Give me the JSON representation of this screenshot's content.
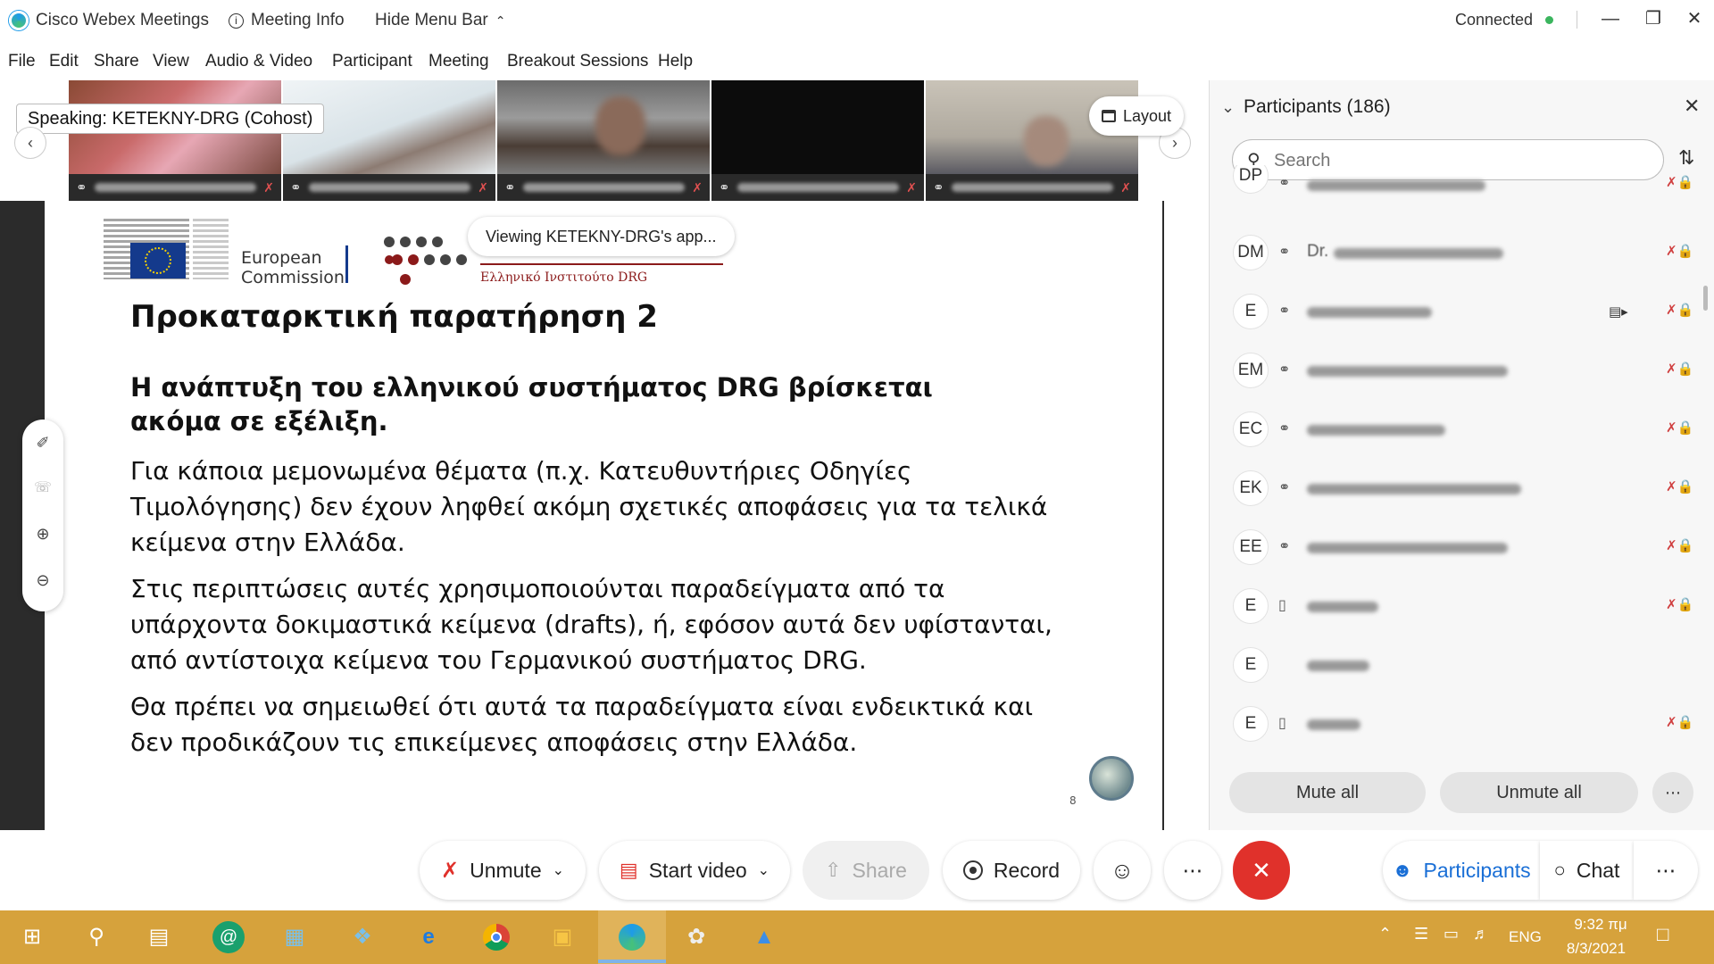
{
  "window": {
    "app_name": "Cisco Webex Meetings",
    "meeting_info": "Meeting Info",
    "hide_menu_bar": "Hide Menu Bar",
    "status": "Connected",
    "status_color": "#3bb55e"
  },
  "menu": [
    "File",
    "Edit",
    "Share",
    "View",
    "Audio & Video",
    "Participant",
    "Meeting",
    "Breakout Sessions",
    "Help"
  ],
  "strip": {
    "speaking": "Speaking: KETEKNY-DRG (Cohost)",
    "layout_label": "Layout"
  },
  "viewing_banner": "Viewing KETEKNY-DRG's app...",
  "slide": {
    "logo_text_line1": "European",
    "logo_text_line2": "Commission",
    "org_text": "Ελληνικό Ινστιτούτο DRG",
    "title": "Προκαταρκτική παρατήρηση 2",
    "subtitle": "Η ανάπτυξη του ελληνικού συστήματος DRG βρίσκεται ακόμα σε εξέλιξη.",
    "paragraph1": "Για κάποια μεμονωμένα θέματα (π.χ. Κατευθυντήριες Οδηγίες Τιμολόγησης) δεν έχουν ληφθεί ακόμη σχετικές αποφάσεις για τα τελικά κείμενα στην Ελλάδα.",
    "paragraph2": "Στις περιπτώσεις αυτές χρησιμοποιούνται παραδείγματα από τα υπάρχοντα δοκιμαστικά κείμενα (drafts), ή, εφόσον αυτά δεν υφίστανται, από αντίστοιχα κείμενα του Γερμανικού συστήματος DRG.",
    "paragraph3": "Θα πρέπει να σημειωθεί ότι αυτά τα παραδείγματα είναι ενδεικτικά και δεν προδικάζουν τις επικείμενες αποφάσεις στην Ελλάδα.",
    "page_number": "8"
  },
  "participants": {
    "header": "Participants (186)",
    "search_placeholder": "Search",
    "rows": [
      {
        "initials": "DP",
        "audio": "headset",
        "video": false,
        "muted": true
      },
      {
        "initials": "DM",
        "audio": "headset",
        "video": false,
        "muted": true,
        "name_prefix": "Dr."
      },
      {
        "initials": "E",
        "audio": "headset",
        "video": true,
        "muted": true
      },
      {
        "initials": "EM",
        "audio": "headset",
        "video": false,
        "muted": true
      },
      {
        "initials": "EC",
        "audio": "headset",
        "video": false,
        "muted": true
      },
      {
        "initials": "EK",
        "audio": "headset",
        "video": false,
        "muted": true
      },
      {
        "initials": "EE",
        "audio": "headset",
        "video": false,
        "muted": true
      },
      {
        "initials": "E",
        "audio": "phone",
        "video": false,
        "muted": true
      },
      {
        "initials": "E",
        "audio": "none",
        "video": false,
        "muted": false
      },
      {
        "initials": "E",
        "audio": "phone",
        "video": false,
        "muted": true
      }
    ],
    "mute_all": "Mute all",
    "unmute_all": "Unmute all"
  },
  "controls": {
    "unmute": "Unmute",
    "start_video": "Start video",
    "share": "Share",
    "record": "Record",
    "participants": "Participants",
    "chat": "Chat",
    "end_color": "#e0312b"
  },
  "taskbar": {
    "language": "ENG",
    "time": "9:32 πμ",
    "date": "8/3/2021",
    "color": "#d6a23c"
  }
}
